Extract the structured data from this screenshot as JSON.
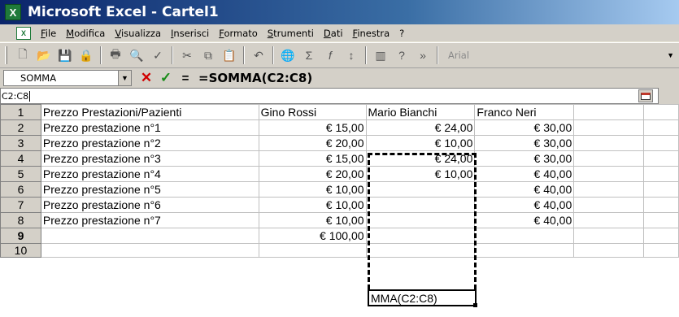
{
  "window": {
    "title": "Microsoft Excel - Cartel1"
  },
  "menu": {
    "items": [
      "File",
      "Modifica",
      "Visualizza",
      "Inserisci",
      "Formato",
      "Strumenti",
      "Dati",
      "Finestra",
      "?"
    ]
  },
  "toolbar": {
    "font_name": "Arial",
    "icons": [
      "new-icon",
      "open-icon",
      "save-icon",
      "permission-icon",
      "print-icon",
      "print-preview-icon",
      "spelling-icon",
      "cut-icon",
      "copy-icon",
      "paste-icon",
      "undo-icon",
      "hyperlink-icon",
      "autosum-icon",
      "function-icon",
      "sort-ascending-icon",
      "chart-wizard-icon",
      "help-icon",
      "more-buttons-icon"
    ]
  },
  "formula_bar": {
    "name_box": "SOMMA",
    "formula": "=SOMMA(C2:C8)"
  },
  "range_bar": {
    "value": "C2:C8"
  },
  "grid": {
    "rows": [
      {
        "n": "1",
        "a": "Prezzo Prestazioni/Pazienti",
        "b": "Gino Rossi",
        "c": "Mario Bianchi",
        "d": "Franco Neri"
      },
      {
        "n": "2",
        "a": "Prezzo prestazione n°1",
        "b": "€ 15,00",
        "c": "€ 24,00",
        "d": "€ 30,00"
      },
      {
        "n": "3",
        "a": "Prezzo prestazione n°2",
        "b": "€ 20,00",
        "c": "€ 10,00",
        "d": "€ 30,00"
      },
      {
        "n": "4",
        "a": "Prezzo prestazione n°3",
        "b": "€ 15,00",
        "c": "€ 24,00",
        "d": "€ 30,00"
      },
      {
        "n": "5",
        "a": "Prezzo prestazione n°4",
        "b": "€ 20,00",
        "c": "€ 10,00",
        "d": "€ 40,00"
      },
      {
        "n": "6",
        "a": "Prezzo prestazione n°5",
        "b": "€ 10,00",
        "c": "",
        "d": "€ 40,00"
      },
      {
        "n": "7",
        "a": "Prezzo prestazione n°6",
        "b": "€ 10,00",
        "c": "",
        "d": "€ 40,00"
      },
      {
        "n": "8",
        "a": "Prezzo prestazione n°7",
        "b": "€ 10,00",
        "c": "",
        "d": "€ 40,00"
      },
      {
        "n": "9",
        "a": "",
        "b": "€ 100,00",
        "c": "",
        "d": ""
      },
      {
        "n": "10",
        "a": "",
        "b": "",
        "c": "",
        "d": ""
      }
    ],
    "editing_text": "MMA(C2:C8)"
  }
}
